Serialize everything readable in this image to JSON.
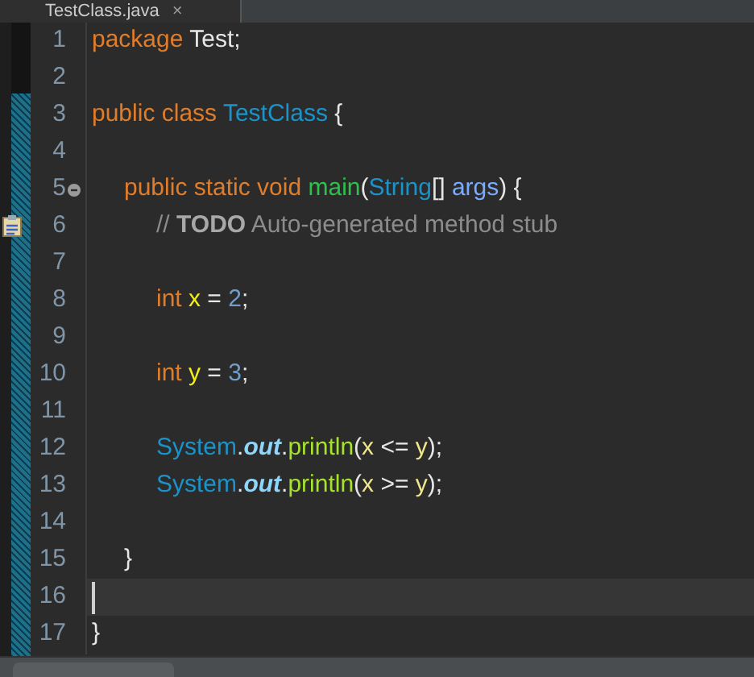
{
  "editor_tab": {
    "title": "TestClass.java",
    "close": "×"
  },
  "lines": [
    {
      "number": "1",
      "fold": false,
      "task_marker": false,
      "current": false,
      "tokens": [
        {
          "text": "package",
          "kind": "keyword"
        },
        {
          "text": " Test;",
          "kind": "plain"
        }
      ]
    },
    {
      "number": "2",
      "fold": false,
      "task_marker": false,
      "current": false
    },
    {
      "number": "3",
      "fold": false,
      "task_marker": false,
      "current": false,
      "tokens": [
        {
          "text": "public class ",
          "kind": "keyword"
        },
        {
          "text": "TestClass",
          "kind": "type"
        },
        {
          "text": " {",
          "kind": "plain"
        }
      ]
    },
    {
      "number": "4",
      "fold": false,
      "task_marker": false,
      "current": false
    },
    {
      "number": "5",
      "fold": true,
      "task_marker": false,
      "current": false,
      "tokens": [
        {
          "text": "\tpublic static void ",
          "kind": "keyword"
        },
        {
          "text": "main",
          "kind": "method"
        },
        {
          "text": "(",
          "kind": "plain"
        },
        {
          "text": "String",
          "kind": "type"
        },
        {
          "text": "[] ",
          "kind": "plain"
        },
        {
          "text": "args",
          "kind": "param"
        },
        {
          "text": ") {",
          "kind": "plain"
        }
      ]
    },
    {
      "number": "6",
      "fold": false,
      "task_marker": true,
      "current": false,
      "tokens": [
        {
          "text": "\t\t// ",
          "kind": "comment"
        },
        {
          "text": "TODO",
          "kind": "task"
        },
        {
          "text": " Auto-generated method stub",
          "kind": "comment"
        }
      ]
    },
    {
      "number": "7",
      "fold": false,
      "task_marker": false,
      "current": false
    },
    {
      "number": "8",
      "fold": false,
      "task_marker": false,
      "current": false,
      "tokens": [
        {
          "text": "\t\tint ",
          "kind": "keyword"
        },
        {
          "text": "x",
          "kind": "variable"
        },
        {
          "text": " = ",
          "kind": "plain"
        },
        {
          "text": "2",
          "kind": "number"
        },
        {
          "text": ";",
          "kind": "plain"
        }
      ]
    },
    {
      "number": "9",
      "fold": false,
      "task_marker": false,
      "current": false
    },
    {
      "number": "10",
      "fold": false,
      "task_marker": false,
      "current": false,
      "tokens": [
        {
          "text": "\t\tint ",
          "kind": "keyword"
        },
        {
          "text": "y",
          "kind": "variable"
        },
        {
          "text": " = ",
          "kind": "plain"
        },
        {
          "text": "3",
          "kind": "number"
        },
        {
          "text": ";",
          "kind": "plain"
        }
      ]
    },
    {
      "number": "11",
      "fold": false,
      "task_marker": false,
      "current": false
    },
    {
      "number": "12",
      "fold": false,
      "task_marker": false,
      "current": false,
      "tokens": [
        {
          "text": "\t\tSystem",
          "kind": "type"
        },
        {
          "text": ".",
          "kind": "plain"
        },
        {
          "text": "out",
          "kind": "field"
        },
        {
          "text": ".",
          "kind": "plain"
        },
        {
          "text": "println",
          "kind": "call"
        },
        {
          "text": "(",
          "kind": "plain"
        },
        {
          "text": "x",
          "kind": "local"
        },
        {
          "text": " <= ",
          "kind": "plain"
        },
        {
          "text": "y",
          "kind": "local"
        },
        {
          "text": ");",
          "kind": "plain"
        }
      ]
    },
    {
      "number": "13",
      "fold": false,
      "task_marker": false,
      "current": false,
      "tokens": [
        {
          "text": "\t\tSystem",
          "kind": "type"
        },
        {
          "text": ".",
          "kind": "plain"
        },
        {
          "text": "out",
          "kind": "field"
        },
        {
          "text": ".",
          "kind": "plain"
        },
        {
          "text": "println",
          "kind": "call"
        },
        {
          "text": "(",
          "kind": "plain"
        },
        {
          "text": "x",
          "kind": "local"
        },
        {
          "text": " >= ",
          "kind": "plain"
        },
        {
          "text": "y",
          "kind": "local"
        },
        {
          "text": ");",
          "kind": "plain"
        }
      ]
    },
    {
      "number": "14",
      "fold": false,
      "task_marker": false,
      "current": false
    },
    {
      "number": "15",
      "fold": false,
      "task_marker": false,
      "current": false,
      "tokens": [
        {
          "text": "\t}",
          "kind": "plain"
        }
      ]
    },
    {
      "number": "16",
      "fold": false,
      "task_marker": false,
      "current": true
    },
    {
      "number": "17",
      "fold": false,
      "task_marker": false,
      "current": false,
      "tokens": [
        {
          "text": "}",
          "kind": "plain"
        }
      ]
    }
  ]
}
